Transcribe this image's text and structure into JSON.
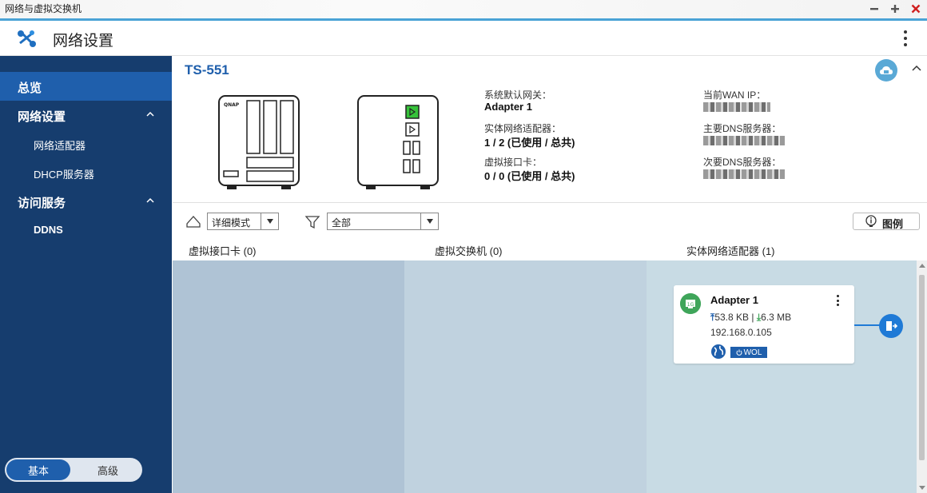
{
  "window": {
    "title": "网络与虚拟交换机"
  },
  "app": {
    "title": "网络设置"
  },
  "sidebar": {
    "overview": "总览",
    "network_settings": "网络设置",
    "network_adapter": "网络适配器",
    "dhcp_server": "DHCP服务器",
    "access_services": "访问服务",
    "ddns": "DDNS",
    "mode_basic": "基本",
    "mode_advanced": "高级"
  },
  "device": {
    "name": "TS-551",
    "default_gateway_label": "系统默认网关：",
    "default_gateway_value": "Adapter 1",
    "physical_adapters_label": "实体网络适配器：",
    "physical_adapters_value": "1 / 2 (已使用 / 总共)",
    "virtual_nic_label": "虚拟接口卡：",
    "virtual_nic_value": "0 / 0 (已使用 / 总共)",
    "wan_ip_label": "当前WAN IP：",
    "primary_dns_label": "主要DNS服务器：",
    "secondary_dns_label": "次要DNS服务器："
  },
  "toolbar": {
    "view_mode": "详细模式",
    "filter": "全部",
    "legend": "图例"
  },
  "columns": {
    "virtual_nic": "虚拟接口卡 (0)",
    "virtual_switch": "虚拟交换机 (0)",
    "physical_adapter": "实体网络适配器 (1)"
  },
  "adapter_card": {
    "name": "Adapter 1",
    "speed_badge": "1G",
    "upload": "53.8 KB",
    "separator": "|",
    "download": "6.3 MB",
    "ip": "192.168.0.105",
    "wol": "WOL"
  },
  "colors": {
    "sidebar_bg": "#163d6e",
    "sidebar_active": "#1f5fac",
    "accent": "#1f5fac",
    "adapter_green": "#3fa55a",
    "link_blue": "#1f7ad6"
  },
  "icons": [
    "app-network-icon",
    "more-vertical-icon",
    "chevron-up-icon",
    "cloud-icon",
    "nas-front-icon",
    "nas-back-icon",
    "switch-icon",
    "filter-icon",
    "info-icon",
    "adapter-icon",
    "globe-icon",
    "power-icon",
    "port-exit-icon"
  ]
}
